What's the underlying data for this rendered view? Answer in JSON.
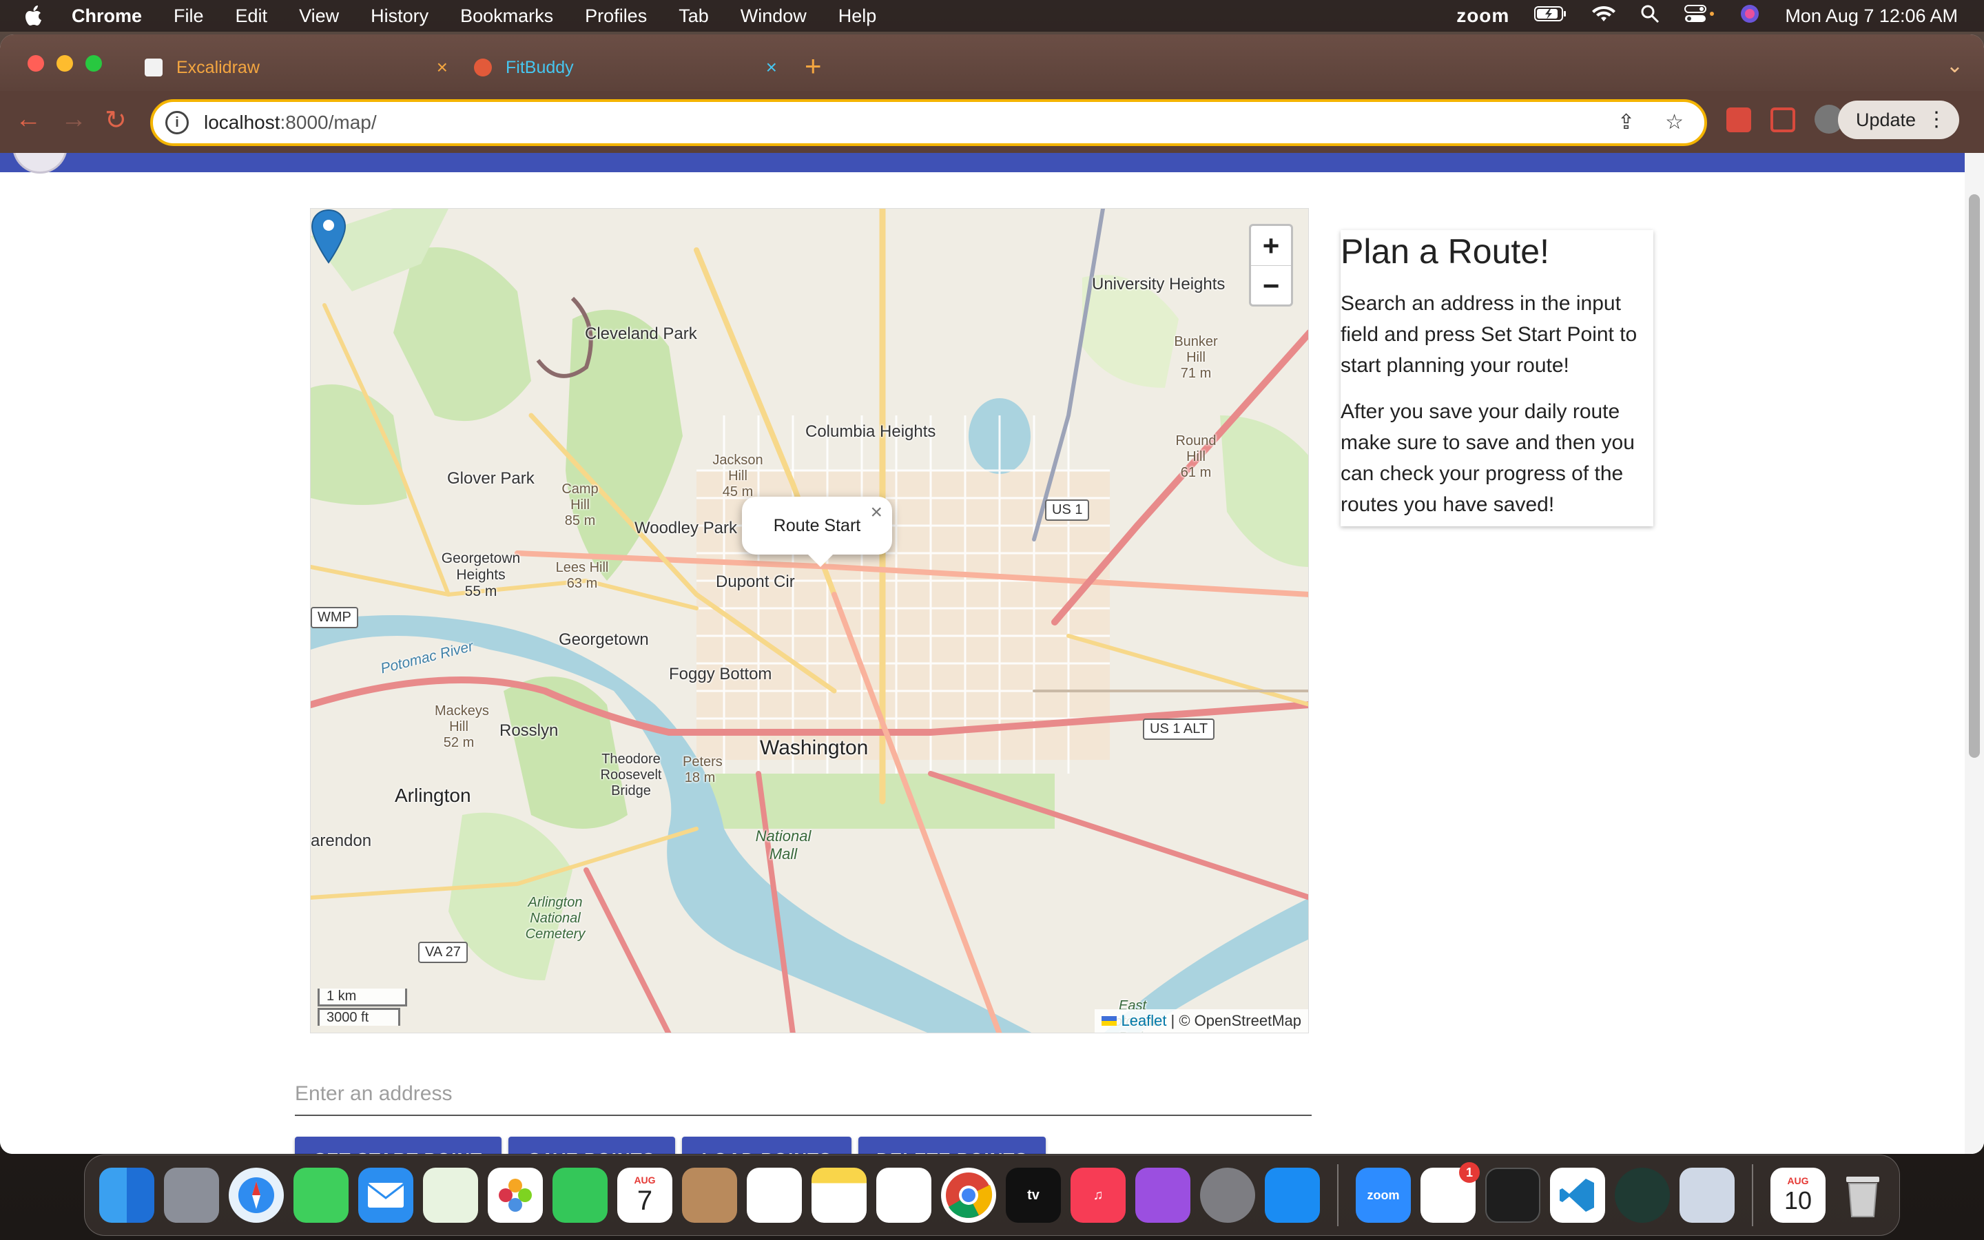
{
  "menubar": {
    "app_name": "Chrome",
    "items": [
      "File",
      "Edit",
      "View",
      "History",
      "Bookmarks",
      "Profiles",
      "Tab",
      "Window",
      "Help"
    ],
    "zoom_label": "zoom",
    "datetime": "Mon Aug 7  12:06 AM"
  },
  "browser": {
    "tabs": [
      {
        "title": "Excalidraw",
        "color": "#f4a640"
      },
      {
        "title": "FitBuddy",
        "color": "#46c6f0"
      }
    ],
    "url_host": "localhost",
    "url_path": ":8000/map/",
    "update_label": "Update"
  },
  "map": {
    "labels": {
      "cleveland_park": "Cleveland Park",
      "woodley_park": "Woodley Park",
      "columbia_heights": "Columbia Heights",
      "glover_park": "Glover Park",
      "university_heights": "University Heights",
      "georgetown_heights": "Georgetown Heights",
      "georgetown_heights_elev": "55 m",
      "dupont": "Dupont Cir",
      "georgetown": "Georgetown",
      "foggy_bottom": "Foggy Bottom",
      "rosslyn": "Rosslyn",
      "washington": "Washington",
      "arlington": "Arlington",
      "arendon": "arendon",
      "national_mall": "National Mall",
      "arlington_cemetery": "Arlington National Cemetery",
      "roosevelt": "Theodore Roosevelt Bridge",
      "potomac": "Potomac River",
      "camp_hill": "Camp Hill",
      "camp_hill_elev": "85 m",
      "jackson_hill": "Jackson Hill",
      "jackson_hill_elev": "45 m",
      "lees_hill": "Lees Hill",
      "lees_hill_elev": "63 m",
      "bunker_hill": "Bunker Hill",
      "bunker_hill_elev": "71 m",
      "round_hill": "Round Hill",
      "round_hill_elev": "61 m",
      "mackeys_hill": "Mackeys Hill",
      "mackeys_hill_elev": "52 m",
      "us1": "US 1",
      "us1alt": "US 1 ALT",
      "va27": "VA 27",
      "wmp": "WMP",
      "east_potomac": "East Potomac Park",
      "peters": "Peters",
      "eighteen": "18 m"
    },
    "zoom_in": "+",
    "zoom_out": "−",
    "popup_text": "Route Start",
    "popup_close": "×",
    "scale_km": "1 km",
    "scale_ft": "3000 ft",
    "attribution_leaflet": "Leaflet",
    "attribution_osm": "| © OpenStreetMap"
  },
  "sidebar": {
    "title": "Plan a Route!",
    "paragraph1": "Search an address in the input field and press Set Start Point to start planning your route!",
    "paragraph2": "After you save your daily route make sure to save and then you can check your progress of the routes you have saved!"
  },
  "form": {
    "address_placeholder": "Enter an address",
    "buttons": {
      "set_start": "SET START POINT",
      "save": "SAVE POINTS",
      "load": "LOAD POINTS",
      "delete": "DELETE POINTS"
    }
  },
  "dock": {
    "calendar_month": "AUG",
    "calendar_day": "7",
    "calendar2_month": "AUG",
    "calendar2_day": "10",
    "zoom_label": "zoom",
    "slack_badge": "1",
    "tv_label": "tv"
  },
  "colors": {
    "primary": "#3f51b5",
    "leaflet_link": "#0078a8",
    "marker": "#2a81cb"
  }
}
